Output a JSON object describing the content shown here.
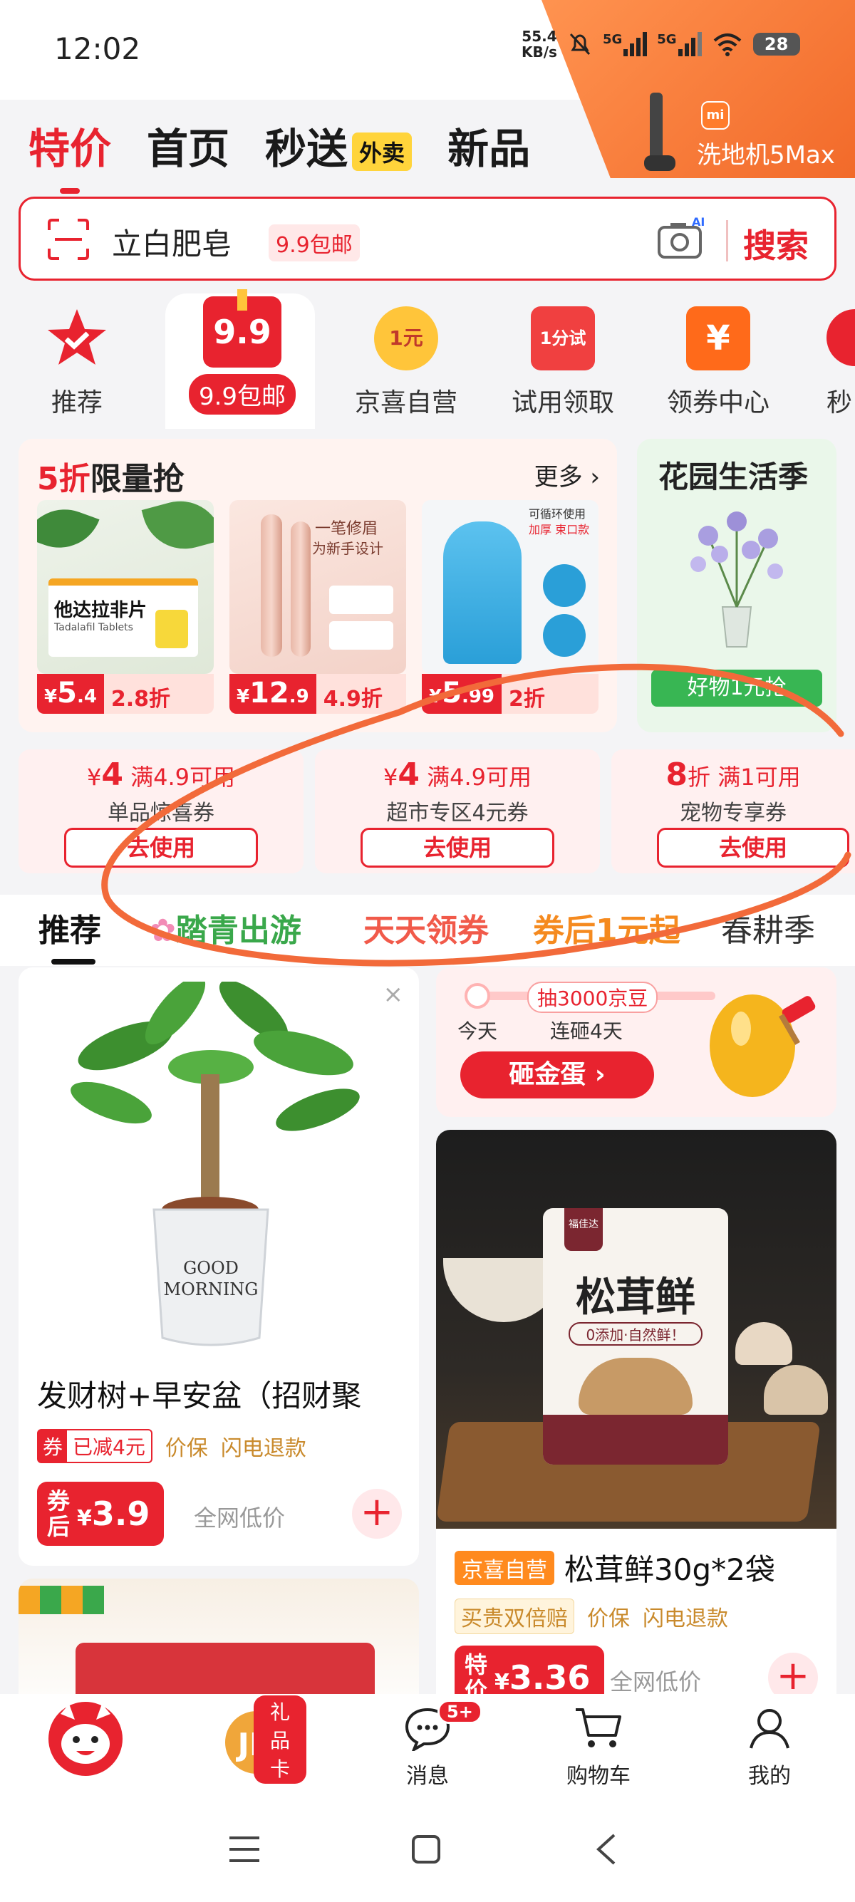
{
  "status_bar": {
    "time": "12:02",
    "net_speed": "55.4",
    "net_unit": "KB/s",
    "signal1": "5G",
    "signal2": "5G",
    "battery": "28"
  },
  "promo": {
    "brand": "mi",
    "text": "洗地机5Max"
  },
  "top_tabs": [
    {
      "label": "特价",
      "active": true
    },
    {
      "label": "首页",
      "active": false
    },
    {
      "label": "秒送",
      "badge": "外卖",
      "active": false
    },
    {
      "label": "新品",
      "active": false
    }
  ],
  "search": {
    "query": "立白肥皂",
    "tag": "9.9包邮",
    "camera_badge": "AI",
    "button": "搜索"
  },
  "categories": [
    {
      "label": "推荐",
      "icon": "star-check-icon"
    },
    {
      "label": "9.9包邮",
      "icon_text": "9.9",
      "icon": "gift-box-icon"
    },
    {
      "label": "京喜自营",
      "icon_text": "1元",
      "icon": "coin-icon"
    },
    {
      "label": "试用领取",
      "icon_text": "1分试",
      "icon": "bag-icon"
    },
    {
      "label": "领券中心",
      "icon_text": "¥",
      "icon": "coupon-icon"
    },
    {
      "label": "秒",
      "icon": "partial-icon"
    }
  ],
  "flash_sale": {
    "title_highlight": "5折",
    "title_rest": "限量抢",
    "more": "更多",
    "items": [
      {
        "product_text": "他达拉非片",
        "sub_text": "Tadalafil Tablets",
        "price": "5",
        "price_decimal": ".4",
        "discount": "2.8折"
      },
      {
        "product_text": "一笔修眉",
        "sub_text": "为新手设计",
        "price": "12",
        "price_decimal": ".9",
        "discount": "4.9折"
      },
      {
        "product_text": "可循环使用",
        "sub_text": "加厚 束口款",
        "price": "5",
        "price_decimal": ".99",
        "discount": "2折"
      }
    ]
  },
  "garden": {
    "title": "花园生活季",
    "button": "好物1元抢"
  },
  "coupons": [
    {
      "amount": "4",
      "condition": "满4.9可用",
      "name": "单品惊喜券",
      "button": "去使用"
    },
    {
      "amount": "4",
      "condition": "满4.9可用",
      "name": "超市专区4元券",
      "button": "去使用"
    },
    {
      "amount": "8",
      "amount_unit": "折",
      "condition": "满1可用",
      "name": "宠物专享券",
      "button": "去使用"
    }
  ],
  "content_tabs": [
    {
      "label": "推荐",
      "active": true
    },
    {
      "label": "踏青出游",
      "icon": "flower-icon"
    },
    {
      "label": "天天领券"
    },
    {
      "label": "券后1元起"
    },
    {
      "label": "春耕季"
    }
  ],
  "feed": {
    "plant": {
      "title": "发财树+早安盆（招财聚",
      "pot_text_1": "GOOD",
      "pot_text_2": "MORNING",
      "coupon_tag": "券",
      "reduced": "已减4元",
      "tags": [
        "价保",
        "闪电退款"
      ],
      "price_prefix": "券后",
      "price": "3.9",
      "low_price": "全网低价"
    },
    "gold_egg": {
      "badge": "抽3000京豆",
      "today": "今天",
      "streak": "连砸4天",
      "button": "砸金蛋"
    },
    "mushroom": {
      "pack_brand": "福佳达",
      "pack_name": "松茸鲜",
      "pack_slogan": "0添加·自然鲜！",
      "shop_tag": "京喜自营",
      "title": "松茸鲜30g*2袋",
      "tags": [
        "买贵双倍赔",
        "价保",
        "闪电退款"
      ],
      "price_prefix": "特价",
      "price": "3.36",
      "low_price": "全网低价"
    }
  },
  "bottom_nav": [
    {
      "label": "",
      "icon": "jd-mascot-icon"
    },
    {
      "label": "",
      "badge": "礼品卡",
      "icon": "jd-coin-icon"
    },
    {
      "label": "消息",
      "badge": "5+",
      "icon": "message-icon"
    },
    {
      "label": "购物车",
      "icon": "cart-icon"
    },
    {
      "label": "我的",
      "icon": "user-icon"
    }
  ],
  "colors": {
    "accent": "#e8232f",
    "annotation": "#f26a3a",
    "green": "#38b653"
  }
}
